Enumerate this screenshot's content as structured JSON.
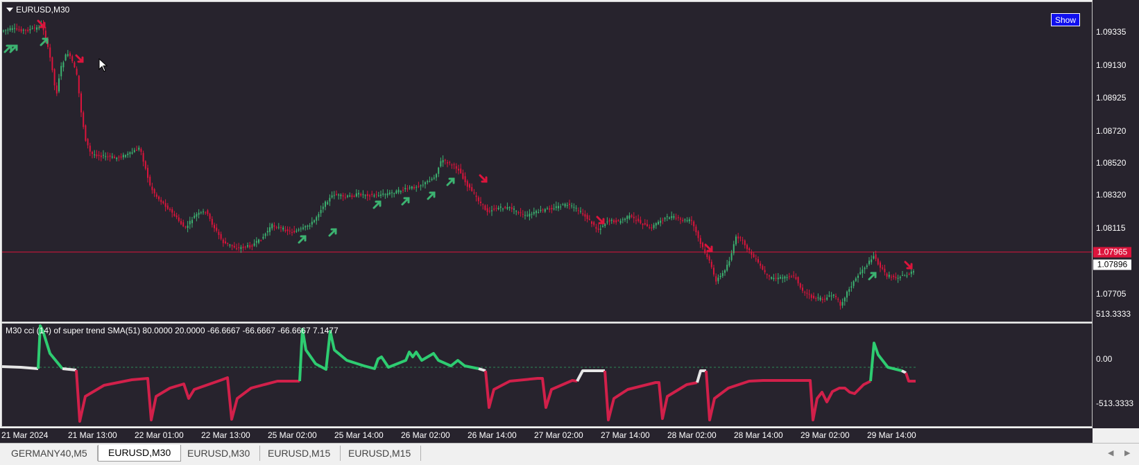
{
  "chart": {
    "symbol_title": "EURUSD,M30",
    "show_button": "Show",
    "indicator_title": "M30 cci (14) of super trend SMA(51) 80.0000 20.0000 -66.6667 -66.6667 -66.6667 7.1477",
    "price_labels": [
      "1.09335",
      "1.09130",
      "1.08925",
      "1.08720",
      "1.08520",
      "1.08320",
      "1.08115",
      "1.07705"
    ],
    "price_values": [
      1.09335,
      1.0913,
      1.08925,
      1.0872,
      1.0852,
      1.0832,
      1.08115,
      1.07705
    ],
    "bid_price": "1.07965",
    "bid_value": 1.07965,
    "ask_price": "1.07896",
    "ask_value": 1.07896,
    "indicator_axis_labels": [
      "513.3333",
      "0.00",
      "-513.3333"
    ],
    "indicator_axis_values": [
      513.3333,
      0,
      -513.3333
    ],
    "time_labels": [
      "21 Mar 2024",
      "21 Mar 13:00",
      "22 Mar 01:00",
      "22 Mar 13:00",
      "25 Mar 02:00",
      "25 Mar 14:00",
      "26 Mar 02:00",
      "26 Mar 14:00",
      "27 Mar 02:00",
      "27 Mar 14:00",
      "28 Mar 02:00",
      "28 Mar 14:00",
      "29 Mar 02:00",
      "29 Mar 14:00"
    ]
  },
  "tabs": [
    {
      "label": "GERMANY40,M5",
      "active": false
    },
    {
      "label": "EURUSD,M30",
      "active": true
    },
    {
      "label": "EURUSD,M30",
      "active": false
    },
    {
      "label": "EURUSD,M15",
      "active": false
    },
    {
      "label": "EURUSD,M15",
      "active": false
    }
  ],
  "colors": {
    "background": "#27232d",
    "bull": "#3cb371",
    "bear": "#dc143c",
    "bid_line": "#dc143c",
    "cci_up": "#2ecc71",
    "cci_down": "#d1204a",
    "cci_neutral": "#e6e6e6"
  }
}
